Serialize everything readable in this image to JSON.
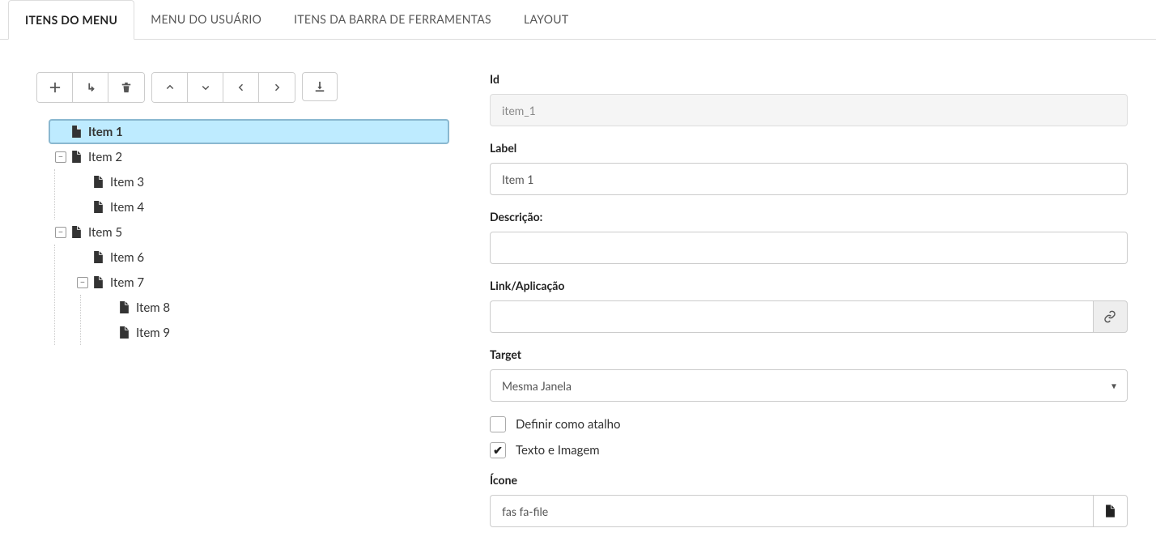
{
  "tabs": [
    {
      "label": "ITENS DO MENU",
      "active": true
    },
    {
      "label": "MENU DO USUÁRIO",
      "active": false
    },
    {
      "label": "ITENS DA BARRA DE FERRAMENTAS",
      "active": false
    },
    {
      "label": "LAYOUT",
      "active": false
    }
  ],
  "tree": {
    "item1": "Item 1",
    "item2": "Item 2",
    "item3": "Item 3",
    "item4": "Item 4",
    "item5": "Item 5",
    "item6": "Item 6",
    "item7": "Item 7",
    "item8": "Item 8",
    "item9": "Item 9"
  },
  "form": {
    "id_label": "Id",
    "id_value": "item_1",
    "label_label": "Label",
    "label_value": "Item 1",
    "desc_label": "Descrição:",
    "desc_value": "",
    "link_label": "Link/Aplicação",
    "link_value": "",
    "target_label": "Target",
    "target_value": "Mesma Janela",
    "shortcut_label": "Definir como atalho",
    "shortcut_checked": false,
    "textimg_label": "Texto e Imagem",
    "textimg_checked": true,
    "icon_label": "Ícone",
    "icon_value": "fas fa-file"
  }
}
